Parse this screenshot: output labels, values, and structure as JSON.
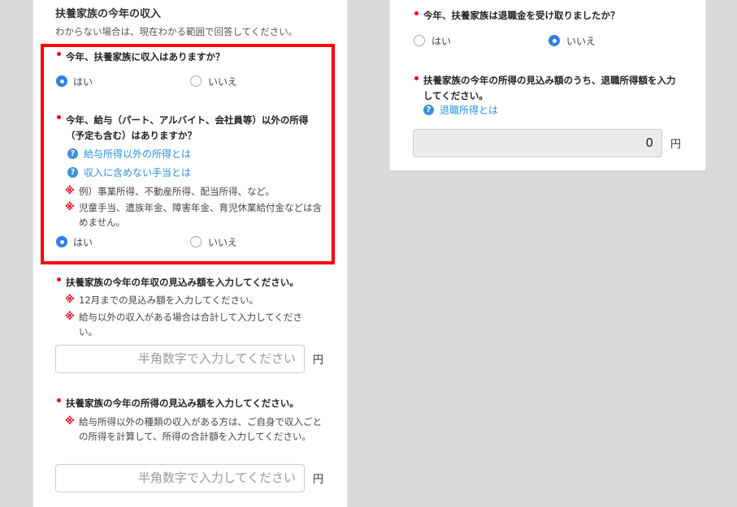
{
  "left": {
    "title": "扶養家族の今年の収入",
    "subtitle": "わからない場合は、現在わかる範囲で回答してください。",
    "q1": {
      "label": "今年、扶養家族に収入はありますか？",
      "options": [
        "はい",
        "いいえ"
      ],
      "selected": "はい"
    },
    "q2": {
      "label": "今年、給与（パート、アルバイト、会社員等）以外の所得（予定も含む）はありますか？",
      "links": [
        "給与所得以外の所得とは",
        "収入に含めない手当とは"
      ],
      "note_mark": "※",
      "notes": [
        "例）事業所得、不動産所得、配当所得、など。",
        "児童手当、遺族年金、障害年金、育児休業給付金などは含めません。"
      ],
      "options": [
        "はい",
        "いいえ"
      ],
      "selected": "はい"
    },
    "q3": {
      "label": "扶養家族の今年の年収の見込み額を入力してください。",
      "notes": [
        "12月までの見込み額を入力してください。",
        "給与以外の収入がある場合は合計して入力してください。"
      ],
      "placeholder": "半角数字で入力してください",
      "unit": "円"
    },
    "q4": {
      "label": "扶養家族の今年の所得の見込み額を入力してください。",
      "notes": [
        "給与所得以外の種類の収入がある方は、ご自身で収入ごとの所得を計算して、所得の合計額を入力してください。"
      ],
      "placeholder": "半角数字で入力してください",
      "unit": "円"
    }
  },
  "right": {
    "q5": {
      "label": "今年、扶養家族は退職金を受け取りましたか？",
      "options": [
        "はい",
        "いいえ"
      ],
      "selected": "いいえ"
    },
    "q6": {
      "label": "扶養家族の今年の所得の見込み額のうち、退職所得額を入力してください。",
      "link": "退職所得とは",
      "value": "0",
      "unit": "円"
    }
  },
  "colors": {
    "accent": "#2f7fe8",
    "required": "#e60012",
    "highlight": "#ff0000",
    "link": "#2a8ee0"
  }
}
